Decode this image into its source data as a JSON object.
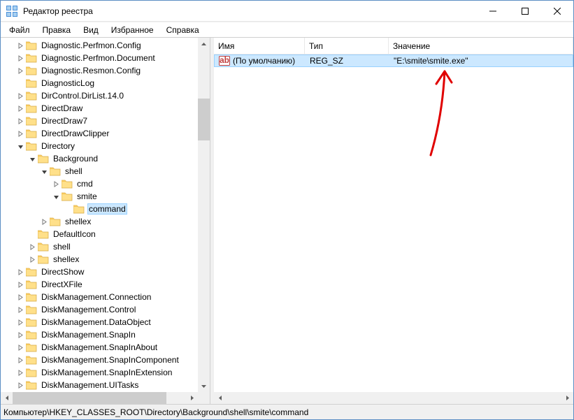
{
  "window": {
    "title": "Редактор реестра"
  },
  "menu": {
    "file": "Файл",
    "edit": "Правка",
    "view": "Вид",
    "favorites": "Избранное",
    "help": "Справка"
  },
  "tree": {
    "items": [
      {
        "depth": 0,
        "exp": "closed",
        "label": "Diagnostic.Perfmon.Config"
      },
      {
        "depth": 0,
        "exp": "closed",
        "label": "Diagnostic.Perfmon.Document"
      },
      {
        "depth": 0,
        "exp": "closed",
        "label": "Diagnostic.Resmon.Config"
      },
      {
        "depth": 0,
        "exp": "none",
        "label": "DiagnosticLog"
      },
      {
        "depth": 0,
        "exp": "closed",
        "label": "DirControl.DirList.14.0"
      },
      {
        "depth": 0,
        "exp": "closed",
        "label": "DirectDraw"
      },
      {
        "depth": 0,
        "exp": "closed",
        "label": "DirectDraw7"
      },
      {
        "depth": 0,
        "exp": "closed",
        "label": "DirectDrawClipper"
      },
      {
        "depth": 0,
        "exp": "open",
        "label": "Directory"
      },
      {
        "depth": 1,
        "exp": "open",
        "label": "Background"
      },
      {
        "depth": 2,
        "exp": "open",
        "label": "shell"
      },
      {
        "depth": 3,
        "exp": "closed",
        "label": "cmd"
      },
      {
        "depth": 3,
        "exp": "open",
        "label": "smite"
      },
      {
        "depth": 4,
        "exp": "none",
        "label": "command",
        "selected": true
      },
      {
        "depth": 2,
        "exp": "closed",
        "label": "shellex"
      },
      {
        "depth": 1,
        "exp": "none",
        "label": "DefaultIcon"
      },
      {
        "depth": 1,
        "exp": "closed",
        "label": "shell"
      },
      {
        "depth": 1,
        "exp": "closed",
        "label": "shellex"
      },
      {
        "depth": 0,
        "exp": "closed",
        "label": "DirectShow"
      },
      {
        "depth": 0,
        "exp": "closed",
        "label": "DirectXFile"
      },
      {
        "depth": 0,
        "exp": "closed",
        "label": "DiskManagement.Connection"
      },
      {
        "depth": 0,
        "exp": "closed",
        "label": "DiskManagement.Control"
      },
      {
        "depth": 0,
        "exp": "closed",
        "label": "DiskManagement.DataObject"
      },
      {
        "depth": 0,
        "exp": "closed",
        "label": "DiskManagement.SnapIn"
      },
      {
        "depth": 0,
        "exp": "closed",
        "label": "DiskManagement.SnapInAbout"
      },
      {
        "depth": 0,
        "exp": "closed",
        "label": "DiskManagement.SnapInComponent"
      },
      {
        "depth": 0,
        "exp": "closed",
        "label": "DiskManagement.SnapInExtension"
      },
      {
        "depth": 0,
        "exp": "closed",
        "label": "DiskManagement.UITasks"
      }
    ]
  },
  "list": {
    "columns": {
      "name": "Имя",
      "type": "Тип",
      "value": "Значение"
    },
    "rows": [
      {
        "name": "(По умолчанию)",
        "type": "REG_SZ",
        "value": "\"E:\\smite\\smite.exe\""
      }
    ]
  },
  "statusbar": {
    "path": "Компьютер\\HKEY_CLASSES_ROOT\\Directory\\Background\\shell\\smite\\command"
  }
}
